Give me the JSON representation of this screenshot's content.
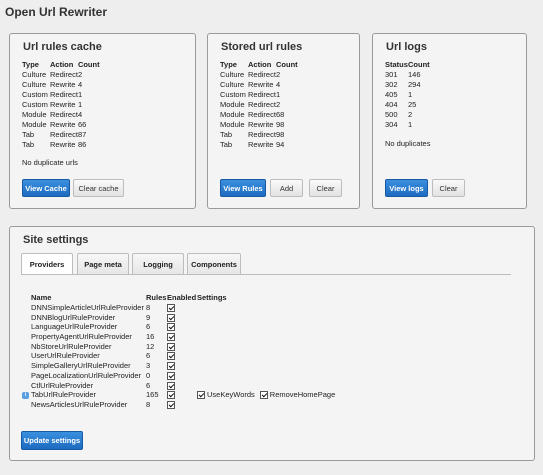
{
  "page": {
    "title": "Open Url Rewriter"
  },
  "cache_panel": {
    "title": "Url rules cache",
    "columns": [
      "Type",
      "Action",
      "Count"
    ],
    "rows": [
      [
        "Culture",
        "Redirect",
        "2"
      ],
      [
        "Culture",
        "Rewrite",
        "4"
      ],
      [
        "Custom",
        "Redirect",
        "1"
      ],
      [
        "Custom",
        "Rewrite",
        "1"
      ],
      [
        "Module",
        "Redirect",
        "4"
      ],
      [
        "Module",
        "Rewrite",
        "66"
      ],
      [
        "Tab",
        "Redirect",
        "87"
      ],
      [
        "Tab",
        "Rewrite",
        "86"
      ]
    ],
    "note": "No duplicate urls",
    "view_label": "View Cache",
    "clear_label": "Clear cache"
  },
  "stored_panel": {
    "title": "Stored url rules",
    "columns": [
      "Type",
      "Action",
      "Count"
    ],
    "rows": [
      [
        "Culture",
        "Redirect",
        "2"
      ],
      [
        "Culture",
        "Rewrite",
        "4"
      ],
      [
        "Custom",
        "Redirect",
        "1"
      ],
      [
        "Module",
        "Redirect",
        "2"
      ],
      [
        "Module",
        "Redirect",
        "68"
      ],
      [
        "Module",
        "Rewrite",
        "98"
      ],
      [
        "Tab",
        "Redirect",
        "98"
      ],
      [
        "Tab",
        "Rewrite",
        "94"
      ]
    ],
    "view_label": "View Rules",
    "add_label": "Add",
    "clear_label": "Clear"
  },
  "logs_panel": {
    "title": "Url logs",
    "columns": [
      "Status",
      "Count"
    ],
    "rows": [
      [
        "301",
        "146"
      ],
      [
        "302",
        "294"
      ],
      [
        "405",
        "1"
      ],
      [
        "404",
        "25"
      ],
      [
        "500",
        "2"
      ],
      [
        "304",
        "1"
      ]
    ],
    "note": "No duplicates",
    "view_label": "View logs",
    "clear_label": "Clear"
  },
  "site_settings": {
    "title": "Site settings",
    "tabs": [
      "Providers",
      "Page meta",
      "Logging",
      "Components"
    ],
    "active_tab": "Providers",
    "columns": [
      "Name",
      "Rules",
      "Enabled",
      "Settings"
    ],
    "providers": [
      {
        "name": "DNNSimpleArticleUrlRuleProvider",
        "rules": "8",
        "enabled": true
      },
      {
        "name": "DNNBlogUrlRuleProvider",
        "rules": "9",
        "enabled": true
      },
      {
        "name": "LanguageUrlRuleProvider",
        "rules": "6",
        "enabled": true
      },
      {
        "name": "PropertyAgentUrlRuleProvider",
        "rules": "16",
        "enabled": true
      },
      {
        "name": "NbStoreUrlRuleProvider",
        "rules": "12",
        "enabled": true
      },
      {
        "name": "UserUrlRuleProvider",
        "rules": "6",
        "enabled": true
      },
      {
        "name": "SimpleGalleryUrlRuleProvider",
        "rules": "3",
        "enabled": true
      },
      {
        "name": "PageLocalizationUrlRuleProvider",
        "rules": "0",
        "enabled": true
      },
      {
        "name": "CtlUrlRuleProvider",
        "rules": "6",
        "enabled": true
      },
      {
        "name": "TabUrlRuleProvider",
        "rules": "165",
        "enabled": true,
        "settings": [
          {
            "label": "UseKeyWords",
            "checked": true
          },
          {
            "label": "RemoveHomePage",
            "checked": true
          }
        ]
      },
      {
        "name": "NewsArticlesUrlRuleProvider",
        "rules": "8",
        "enabled": true
      }
    ],
    "update_label": "Update settings"
  }
}
